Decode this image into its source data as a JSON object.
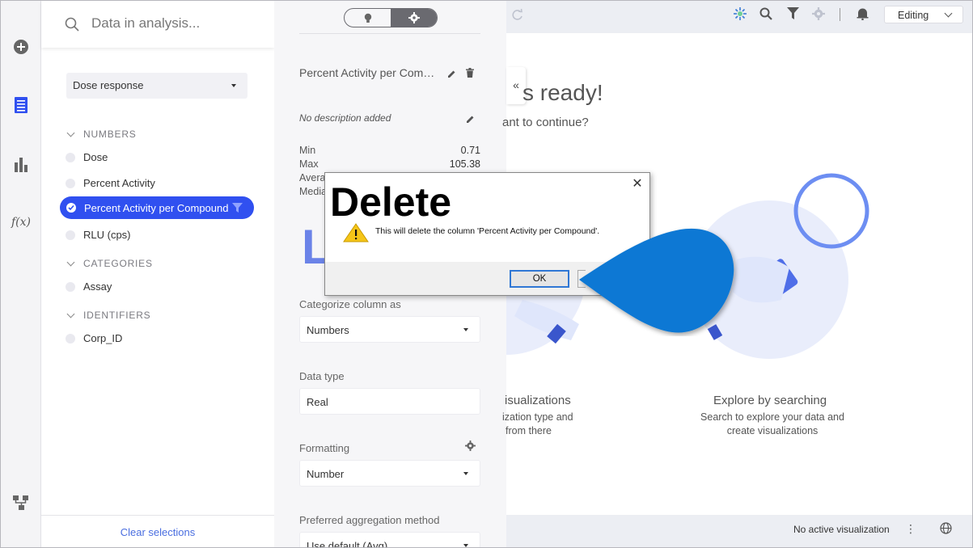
{
  "search": {
    "placeholder": "Data in analysis..."
  },
  "data_table": {
    "selected": "Dose response"
  },
  "sections": {
    "numbers": "NUMBERS",
    "categories": "CATEGORIES",
    "identifiers": "IDENTIFIERS"
  },
  "columns": {
    "numbers": [
      "Dose",
      "Percent Activity",
      "Percent Activity per Compound",
      "RLU (cps)"
    ],
    "categories": [
      "Assay"
    ],
    "identifiers": [
      "Corp_ID"
    ]
  },
  "clear_selections": "Clear selections",
  "details": {
    "column_title": "Percent Activity per Compound",
    "description": "No description added",
    "stats": [
      {
        "label": "Min",
        "value": "0.71"
      },
      {
        "label": "Max",
        "value": "105.38"
      },
      {
        "label": "Avera",
        "value": ""
      },
      {
        "label": "Media",
        "value": ""
      }
    ],
    "big_glyph": "L",
    "categorize_label": "Categorize column as",
    "categorize_value": "Numbers",
    "datatype_label": "Data type",
    "datatype_value": "Real",
    "formatting_label": "Formatting",
    "formatting_value": "Number",
    "aggregation_label": "Preferred aggregation method",
    "aggregation_value": "Use default (Avg)"
  },
  "toolbar": {
    "mode": "Editing"
  },
  "main": {
    "ready_title": "s ready!",
    "ready_sub": "ant to continue?",
    "card_left_title": "isualizations",
    "card_left_text_1": "ization type and",
    "card_left_text_2": "from there",
    "card_right_title": "Explore by searching",
    "card_right_text_1": "Search to explore your data and",
    "card_right_text_2": "create visualizations"
  },
  "status": {
    "text": "No active visualization"
  },
  "dialog": {
    "title": "Delete",
    "message": "This will delete the column 'Percent Activity per Compound'.",
    "ok": "OK"
  },
  "colors": {
    "accent": "#3050f0",
    "pointer": "#0a78d4",
    "illustration": "#e9edfb"
  }
}
